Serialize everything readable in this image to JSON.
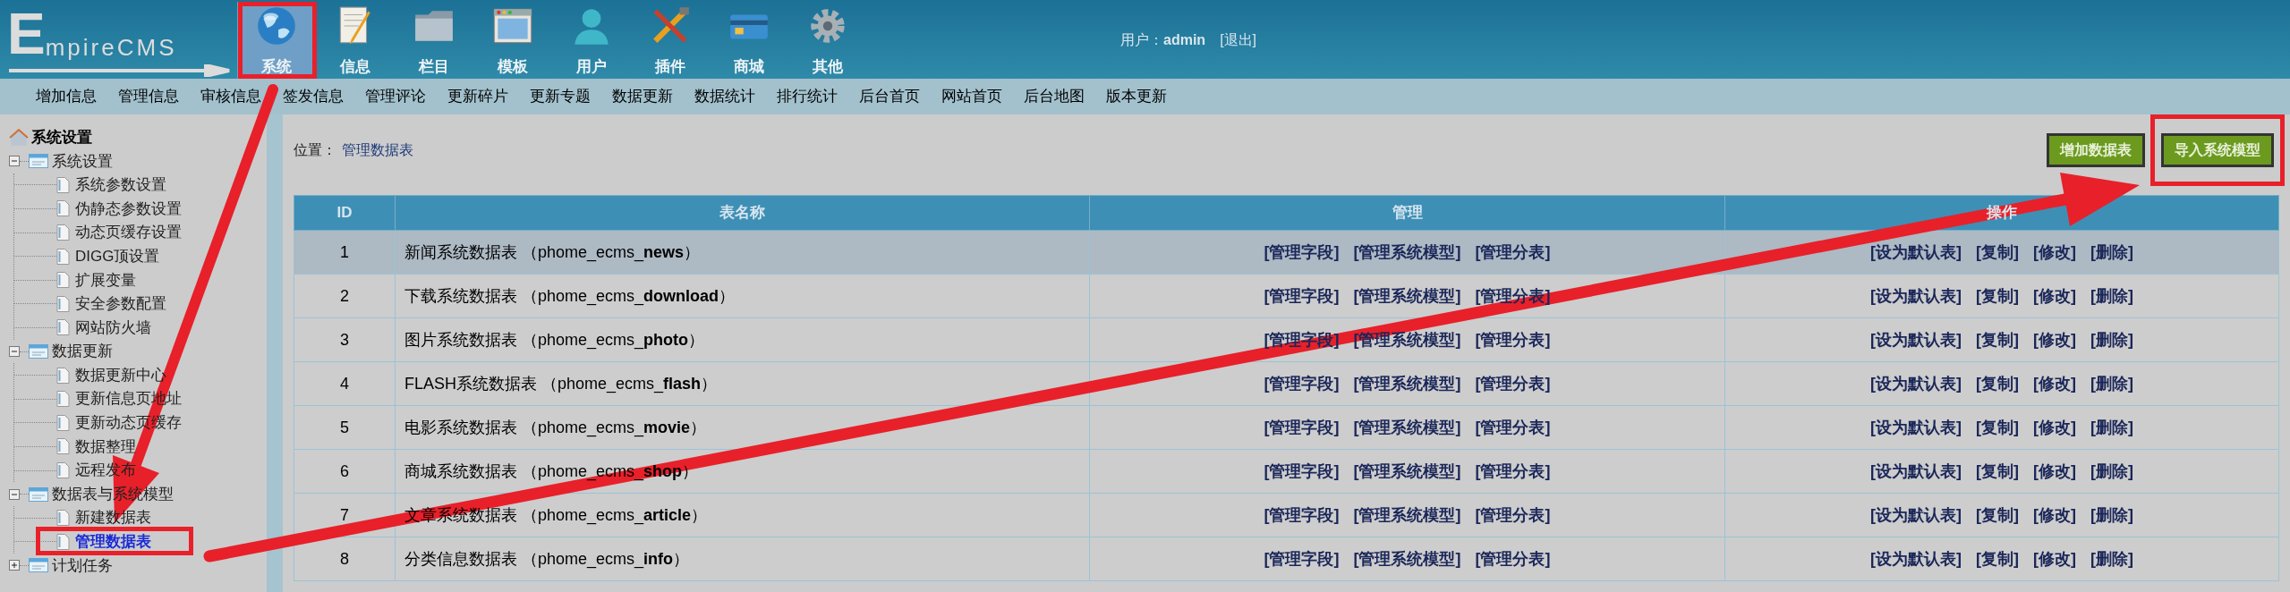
{
  "logo": "EmpireCMS",
  "nav": [
    {
      "label": "系统",
      "selected": true
    },
    {
      "label": "信息",
      "selected": false
    },
    {
      "label": "栏目",
      "selected": false
    },
    {
      "label": "模板",
      "selected": false
    },
    {
      "label": "用户",
      "selected": false
    },
    {
      "label": "插件",
      "selected": false
    },
    {
      "label": "商城",
      "selected": false
    },
    {
      "label": "其他",
      "selected": false
    }
  ],
  "user": {
    "label": "用户：",
    "name": "admin",
    "logout": "[退出]"
  },
  "menu": [
    "增加信息",
    "管理信息",
    "审核信息",
    "签发信息",
    "管理评论",
    "更新碎片",
    "更新专题",
    "数据更新",
    "数据统计",
    "排行统计",
    "后台首页",
    "网站首页",
    "后台地图",
    "版本更新"
  ],
  "sidebar": {
    "title": "系统设置",
    "groups": [
      {
        "label": "系统设置",
        "expanded": true,
        "children": [
          {
            "label": "系统参数设置",
            "selected": false
          },
          {
            "label": "伪静态参数设置",
            "selected": false
          },
          {
            "label": "动态页缓存设置",
            "selected": false
          },
          {
            "label": "DIGG顶设置",
            "selected": false
          },
          {
            "label": "扩展变量",
            "selected": false
          },
          {
            "label": "安全参数配置",
            "selected": false
          },
          {
            "label": "网站防火墙",
            "selected": false
          }
        ]
      },
      {
        "label": "数据更新",
        "expanded": true,
        "children": [
          {
            "label": "数据更新中心",
            "selected": false
          },
          {
            "label": "更新信息页地址",
            "selected": false
          },
          {
            "label": "更新动态页缓存",
            "selected": false
          },
          {
            "label": "数据整理",
            "selected": false
          },
          {
            "label": "远程发布",
            "selected": false
          }
        ]
      },
      {
        "label": "数据表与系统模型",
        "expanded": true,
        "children": [
          {
            "label": "新建数据表",
            "selected": false
          },
          {
            "label": "管理数据表",
            "selected": true
          }
        ]
      },
      {
        "label": "计划任务",
        "expanded": false
      }
    ]
  },
  "breadcrumb": {
    "label": "位置：",
    "current": "管理数据表"
  },
  "buttons": [
    "增加数据表",
    "导入系统模型"
  ],
  "table": {
    "columns": [
      "ID",
      "表名称",
      "管理",
      "操作"
    ],
    "rows": [
      {
        "id": "1",
        "name": "新闻系统数据表 （phome_ecms_**news**）",
        "selected": true,
        "manage": [
          "[管理字段]",
          "[管理系统模型]",
          "[管理分表]"
        ],
        "actions": [
          "[设为默认表]",
          "[复制]",
          "[修改]",
          "[删除]"
        ]
      },
      {
        "id": "2",
        "name": "下载系统数据表 （phome_ecms_**download**）",
        "selected": false,
        "manage": [
          "[管理字段]",
          "[管理系统模型]",
          "[管理分表]"
        ],
        "actions": [
          "[设为默认表]",
          "[复制]",
          "[修改]",
          "[删除]"
        ]
      },
      {
        "id": "3",
        "name": "图片系统数据表 （phome_ecms_**photo**）",
        "selected": false,
        "manage": [
          "[管理字段]",
          "[管理系统模型]",
          "[管理分表]"
        ],
        "actions": [
          "[设为默认表]",
          "[复制]",
          "[修改]",
          "[删除]"
        ]
      },
      {
        "id": "4",
        "name": "FLASH系统数据表 （phome_ecms_**flash**）",
        "selected": false,
        "manage": [
          "[管理字段]",
          "[管理系统模型]",
          "[管理分表]"
        ],
        "actions": [
          "[设为默认表]",
          "[复制]",
          "[修改]",
          "[删除]"
        ]
      },
      {
        "id": "5",
        "name": "电影系统数据表 （phome_ecms_**movie**）",
        "selected": false,
        "manage": [
          "[管理字段]",
          "[管理系统模型]",
          "[管理分表]"
        ],
        "actions": [
          "[设为默认表]",
          "[复制]",
          "[修改]",
          "[删除]"
        ]
      },
      {
        "id": "6",
        "name": "商城系统数据表 （phome_ecms_**shop**）",
        "selected": false,
        "manage": [
          "[管理字段]",
          "[管理系统模型]",
          "[管理分表]"
        ],
        "actions": [
          "[设为默认表]",
          "[复制]",
          "[修改]",
          "[删除]"
        ]
      },
      {
        "id": "7",
        "name": "文章系统数据表 （phome_ecms_**article**）",
        "selected": false,
        "manage": [
          "[管理字段]",
          "[管理系统模型]",
          "[管理分表]"
        ],
        "actions": [
          "[设为默认表]",
          "[复制]",
          "[修改]",
          "[删除]"
        ]
      },
      {
        "id": "8",
        "name": "分类信息数据表 （phome_ecms_**info**）",
        "selected": false,
        "manage": [
          "[管理字段]",
          "[管理系统模型]",
          "[管理分表]"
        ],
        "actions": [
          "[设为默认表]",
          "[复制]",
          "[修改]",
          "[删除]"
        ]
      }
    ]
  }
}
